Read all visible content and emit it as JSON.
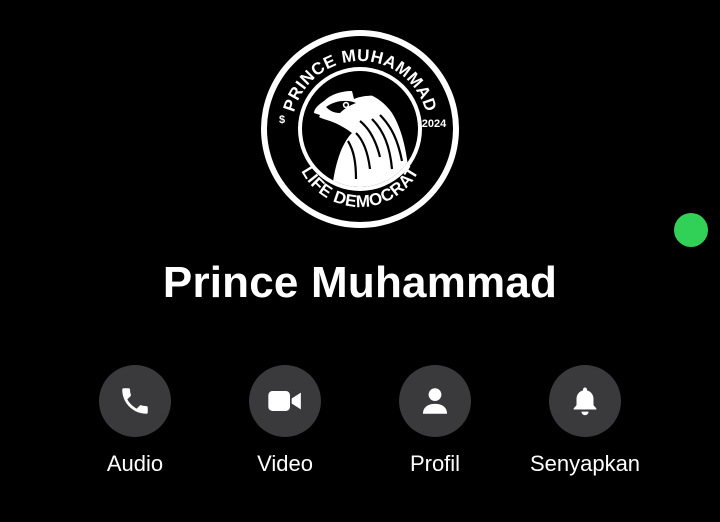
{
  "contact": {
    "name": "Prince Muhammad",
    "online": true,
    "avatar": {
      "logo_text_top": "PRINCE MUHAMMAD",
      "logo_text_bottom": "LIFE DEMOCRAT",
      "logo_year": "2024",
      "logo_symbol": "$",
      "logo_icon": "eagle-icon"
    }
  },
  "actions": [
    {
      "id": "audio",
      "label": "Audio",
      "icon": "phone-icon"
    },
    {
      "id": "video",
      "label": "Video",
      "icon": "video-camera-icon"
    },
    {
      "id": "profile",
      "label": "Profil",
      "icon": "person-icon"
    },
    {
      "id": "mute",
      "label": "Senyapkan",
      "icon": "bell-icon"
    }
  ],
  "colors": {
    "background": "#000000",
    "text": "#ffffff",
    "button_bg": "#3a3a3c",
    "online": "#31d158"
  }
}
